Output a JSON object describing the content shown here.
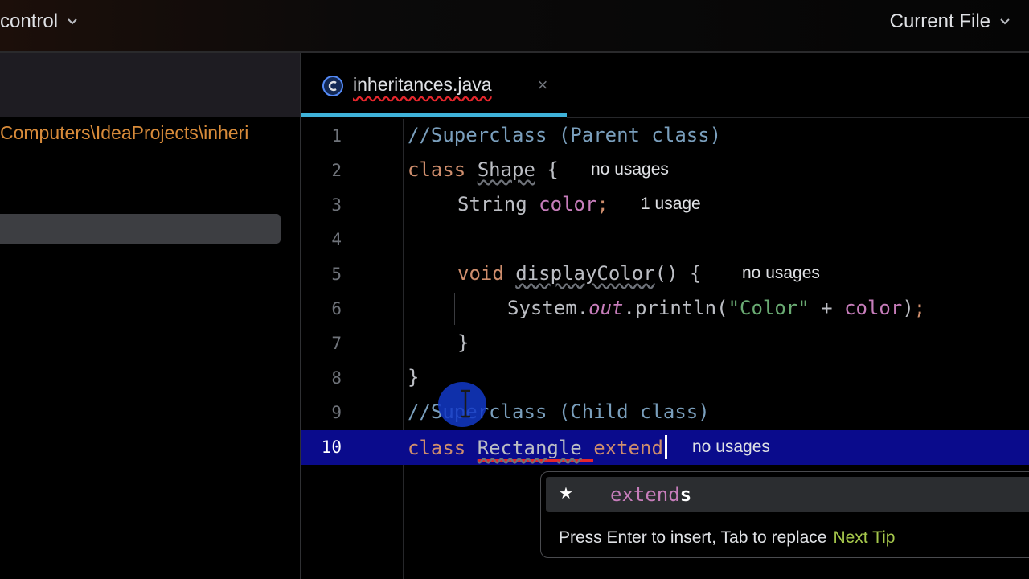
{
  "topbar": {
    "vcs_label": "control",
    "run_config_label": "Current File"
  },
  "project": {
    "path": "Computers\\IdeaProjects\\inheri"
  },
  "tab": {
    "filename": "inheritances.java",
    "icon": "java-class-icon",
    "close_glyph": "×"
  },
  "editor": {
    "lines": [
      {
        "n": "1",
        "text": "//Superclass (Parent class)"
      },
      {
        "n": "2",
        "text": "class Shape {",
        "hint": "no usages"
      },
      {
        "n": "3",
        "text": "String color;",
        "hint": "1 usage"
      },
      {
        "n": "4",
        "text": ""
      },
      {
        "n": "5",
        "text": "void displayColor() {",
        "hint": "no usages"
      },
      {
        "n": "6",
        "text": "System.out.println(\"Color\" + color);"
      },
      {
        "n": "7",
        "text": "}"
      },
      {
        "n": "8",
        "text": "}"
      },
      {
        "n": "9",
        "text": "//Superclass (Child class)"
      },
      {
        "n": "10",
        "text": "class Rectangle extend",
        "hint": "no usages"
      }
    ],
    "current_line": "10"
  },
  "completion": {
    "star": "★",
    "prefix": "extend",
    "suffix": "s",
    "footer": "Press Enter to insert, Tab to replace",
    "next_tip": "Next Tip"
  },
  "colors": {
    "keyword": "#cf8e6d",
    "comment": "#7a9fbd",
    "field": "#c77dbb",
    "string": "#6aab73",
    "current_line": "#0a0b8c",
    "tab_indicator": "#3fb2d9",
    "path_text": "#d88b3a",
    "next_tip": "#a6c84c"
  }
}
